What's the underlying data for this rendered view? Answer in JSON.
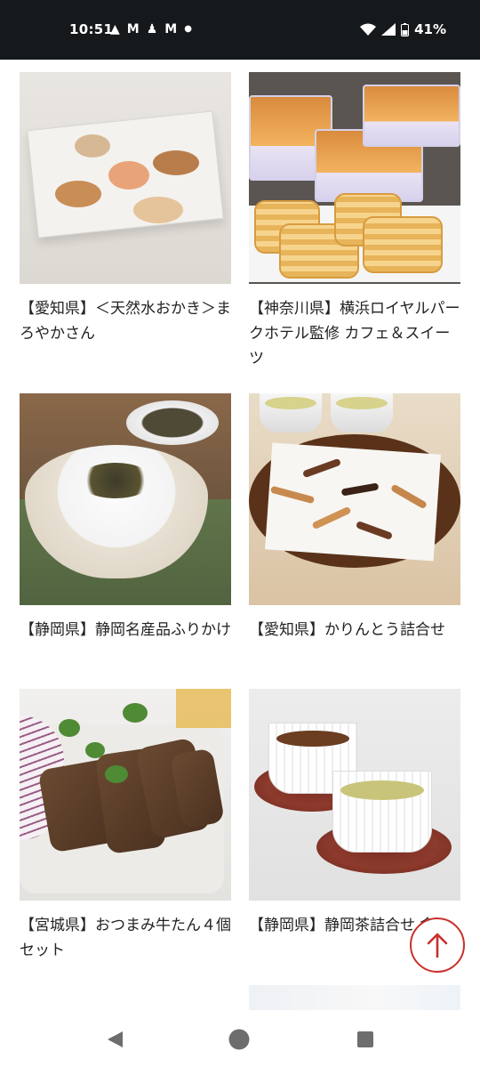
{
  "status_bar": {
    "time": "10:51",
    "left_icons": [
      "warning-icon",
      "gmail-icon",
      "figure-icon",
      "gmail-icon",
      "dot-icon"
    ],
    "battery": "41%",
    "right_icons": [
      "wifi-icon",
      "signal-icon",
      "battery-icon"
    ]
  },
  "products": [
    {
      "caption": "【愛知県】＜天然水おかき＞まろやかさん",
      "image": "rice-crackers-on-plate"
    },
    {
      "caption": "【神奈川県】横浜ロイヤルパークホテル監修 カフェ＆スイーツ",
      "image": "waffles-with-packs"
    },
    {
      "caption": "【静岡県】静岡名産品ふりかけ",
      "image": "rice-with-furikake"
    },
    {
      "caption": "【愛知県】かりんとう詰合せ",
      "image": "karinto-on-tray"
    },
    {
      "caption": "【宮城県】おつまみ牛たん４個セット",
      "image": "beef-tongue-plate"
    },
    {
      "caption": "【静岡県】静岡茶詰合せ 倉",
      "image": "tea-cups"
    }
  ],
  "back_to_top": {
    "icon": "arrow-up-icon",
    "color": "#c9302c"
  },
  "nav_bar": {
    "icons": [
      "back-triangle-icon",
      "home-circle-icon",
      "recents-square-icon"
    ]
  }
}
